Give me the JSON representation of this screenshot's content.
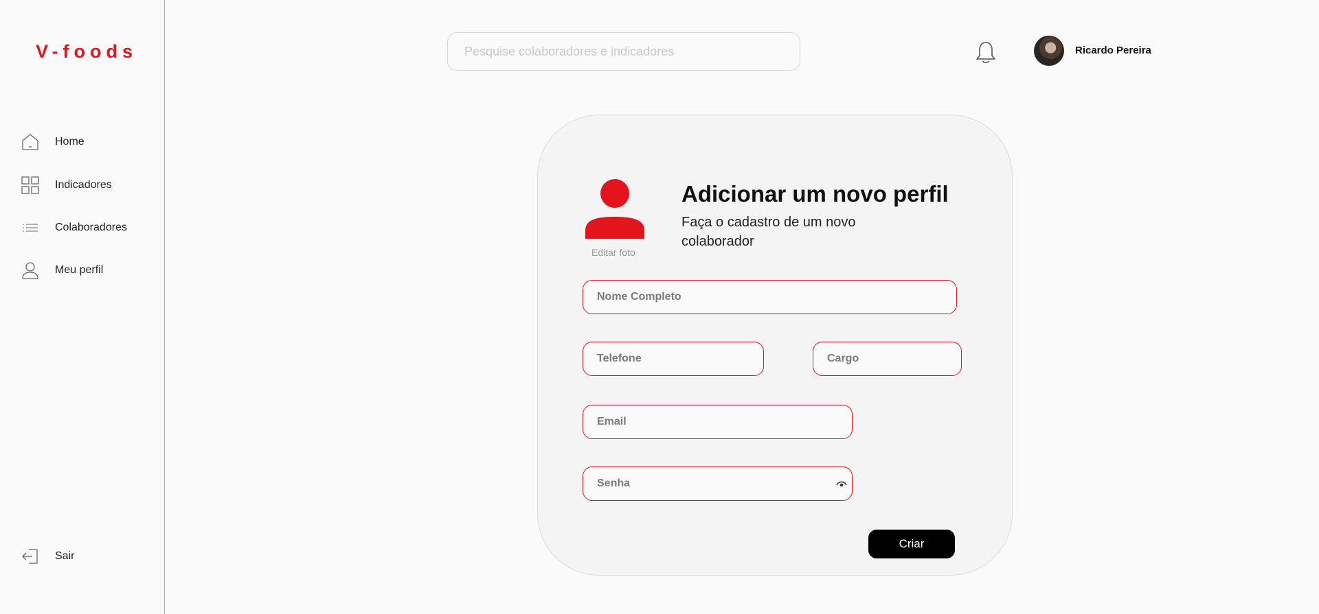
{
  "brand": {
    "logo_text": "V-foods",
    "accent_color": "#e3141b",
    "divider_color": "#58c7e4"
  },
  "sidebar": {
    "items": [
      {
        "label": "Home",
        "icon": "home-icon"
      },
      {
        "label": "Indicadores",
        "icon": "grid-icon"
      },
      {
        "label": "Colaboradores",
        "icon": "list-icon"
      },
      {
        "label": "Meu perfil",
        "icon": "user-icon"
      }
    ],
    "logout": {
      "label": "Sair",
      "icon": "logout-icon"
    }
  },
  "header": {
    "search_placeholder": "Pesquise colaboradores e indicadores",
    "notification_icon": "bell-icon",
    "user_name": "Ricardo Pereira"
  },
  "form": {
    "title": "Adicionar um novo perfil",
    "subtitle": "Faça o cadastro de um novo colaborador",
    "edit_photo_label": "Editar foto",
    "fields": {
      "name_placeholder": "Nome Completo",
      "phone_placeholder": "Telefone",
      "role_placeholder": "Cargo",
      "email_placeholder": "Email",
      "password_placeholder": "Senha"
    },
    "submit_label": "Criar"
  }
}
